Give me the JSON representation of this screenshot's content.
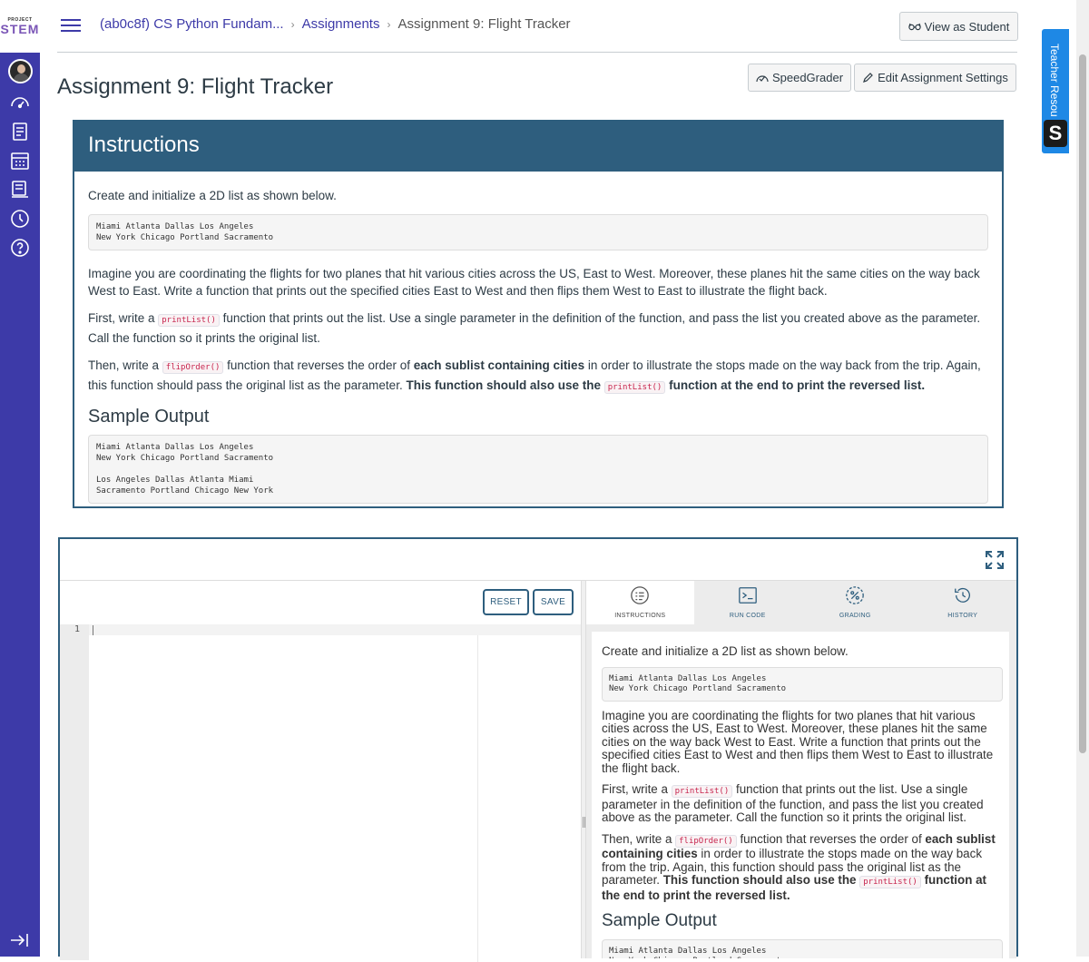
{
  "logo": {
    "line1": "PROJECT",
    "line2": "STEM"
  },
  "breadcrumb": {
    "course": "(ab0c8f) CS Python Fundam...",
    "section": "Assignments",
    "current": "Assignment 9: Flight Tracker"
  },
  "header": {
    "view_as_student": "View as Student",
    "speedgrader": "SpeedGrader",
    "edit_settings": "Edit Assignment Settings"
  },
  "teacher_tab": {
    "label": "Teacher Resou",
    "badge": "S"
  },
  "page_title": "Assignment 9: Flight Tracker",
  "instructions": {
    "heading": "Instructions",
    "intro": "Create and initialize a 2D list as shown below.",
    "code_list": "Miami Atlanta Dallas Los Angeles\nNew York Chicago Portland Sacramento",
    "para1": "Imagine you are coordinating the flights for two planes that hit various cities across the US, East to West. Moreover, these planes hit the same cities on the way back West to East. Write a function that prints out the specified cities East to West and then flips them West to East to illustrate the flight back.",
    "para2_a": "First, write a ",
    "para2_code": "printList()",
    "para2_b": " function that prints out the list. Use a single parameter in the definition of the function, and pass the list you created above as the parameter. Call the function so it prints the original list.",
    "para3_a": "Then, write a ",
    "para3_code": "flipOrder()",
    "para3_b": " function that reverses the order of ",
    "para3_bold1": "each sublist containing cities",
    "para3_c": " in order to illustrate the stops made on the way back from the trip. Again, this function should pass the original list as the parameter. ",
    "para3_bold2": "This function should also use the ",
    "para3_code2": "printList()",
    "para3_bold3": " function at the end to print the reversed list.",
    "sample_heading": "Sample Output",
    "sample_code": "Miami Atlanta Dallas Los Angeles\nNew York Chicago Portland Sacramento\n\nLos Angeles Dallas Atlanta Miami\nSacramento Portland Chicago New York",
    "sample_code_short": "Miami Atlanta Dallas Los Angeles\nNew York Chicago Portland Sacramento"
  },
  "ide": {
    "reset": "RESET",
    "save": "SAVE",
    "line_number": "1",
    "tabs": [
      {
        "label": "INSTRUCTIONS",
        "icon": "instructions-icon"
      },
      {
        "label": "RUN CODE",
        "icon": "terminal-icon"
      },
      {
        "label": "GRADING",
        "icon": "grading-icon"
      },
      {
        "label": "HISTORY",
        "icon": "history-icon"
      }
    ]
  },
  "colors": {
    "nav": "#3d3aa8",
    "accent": "#2e5e7e",
    "teacher_tab": "#1e88e5"
  }
}
